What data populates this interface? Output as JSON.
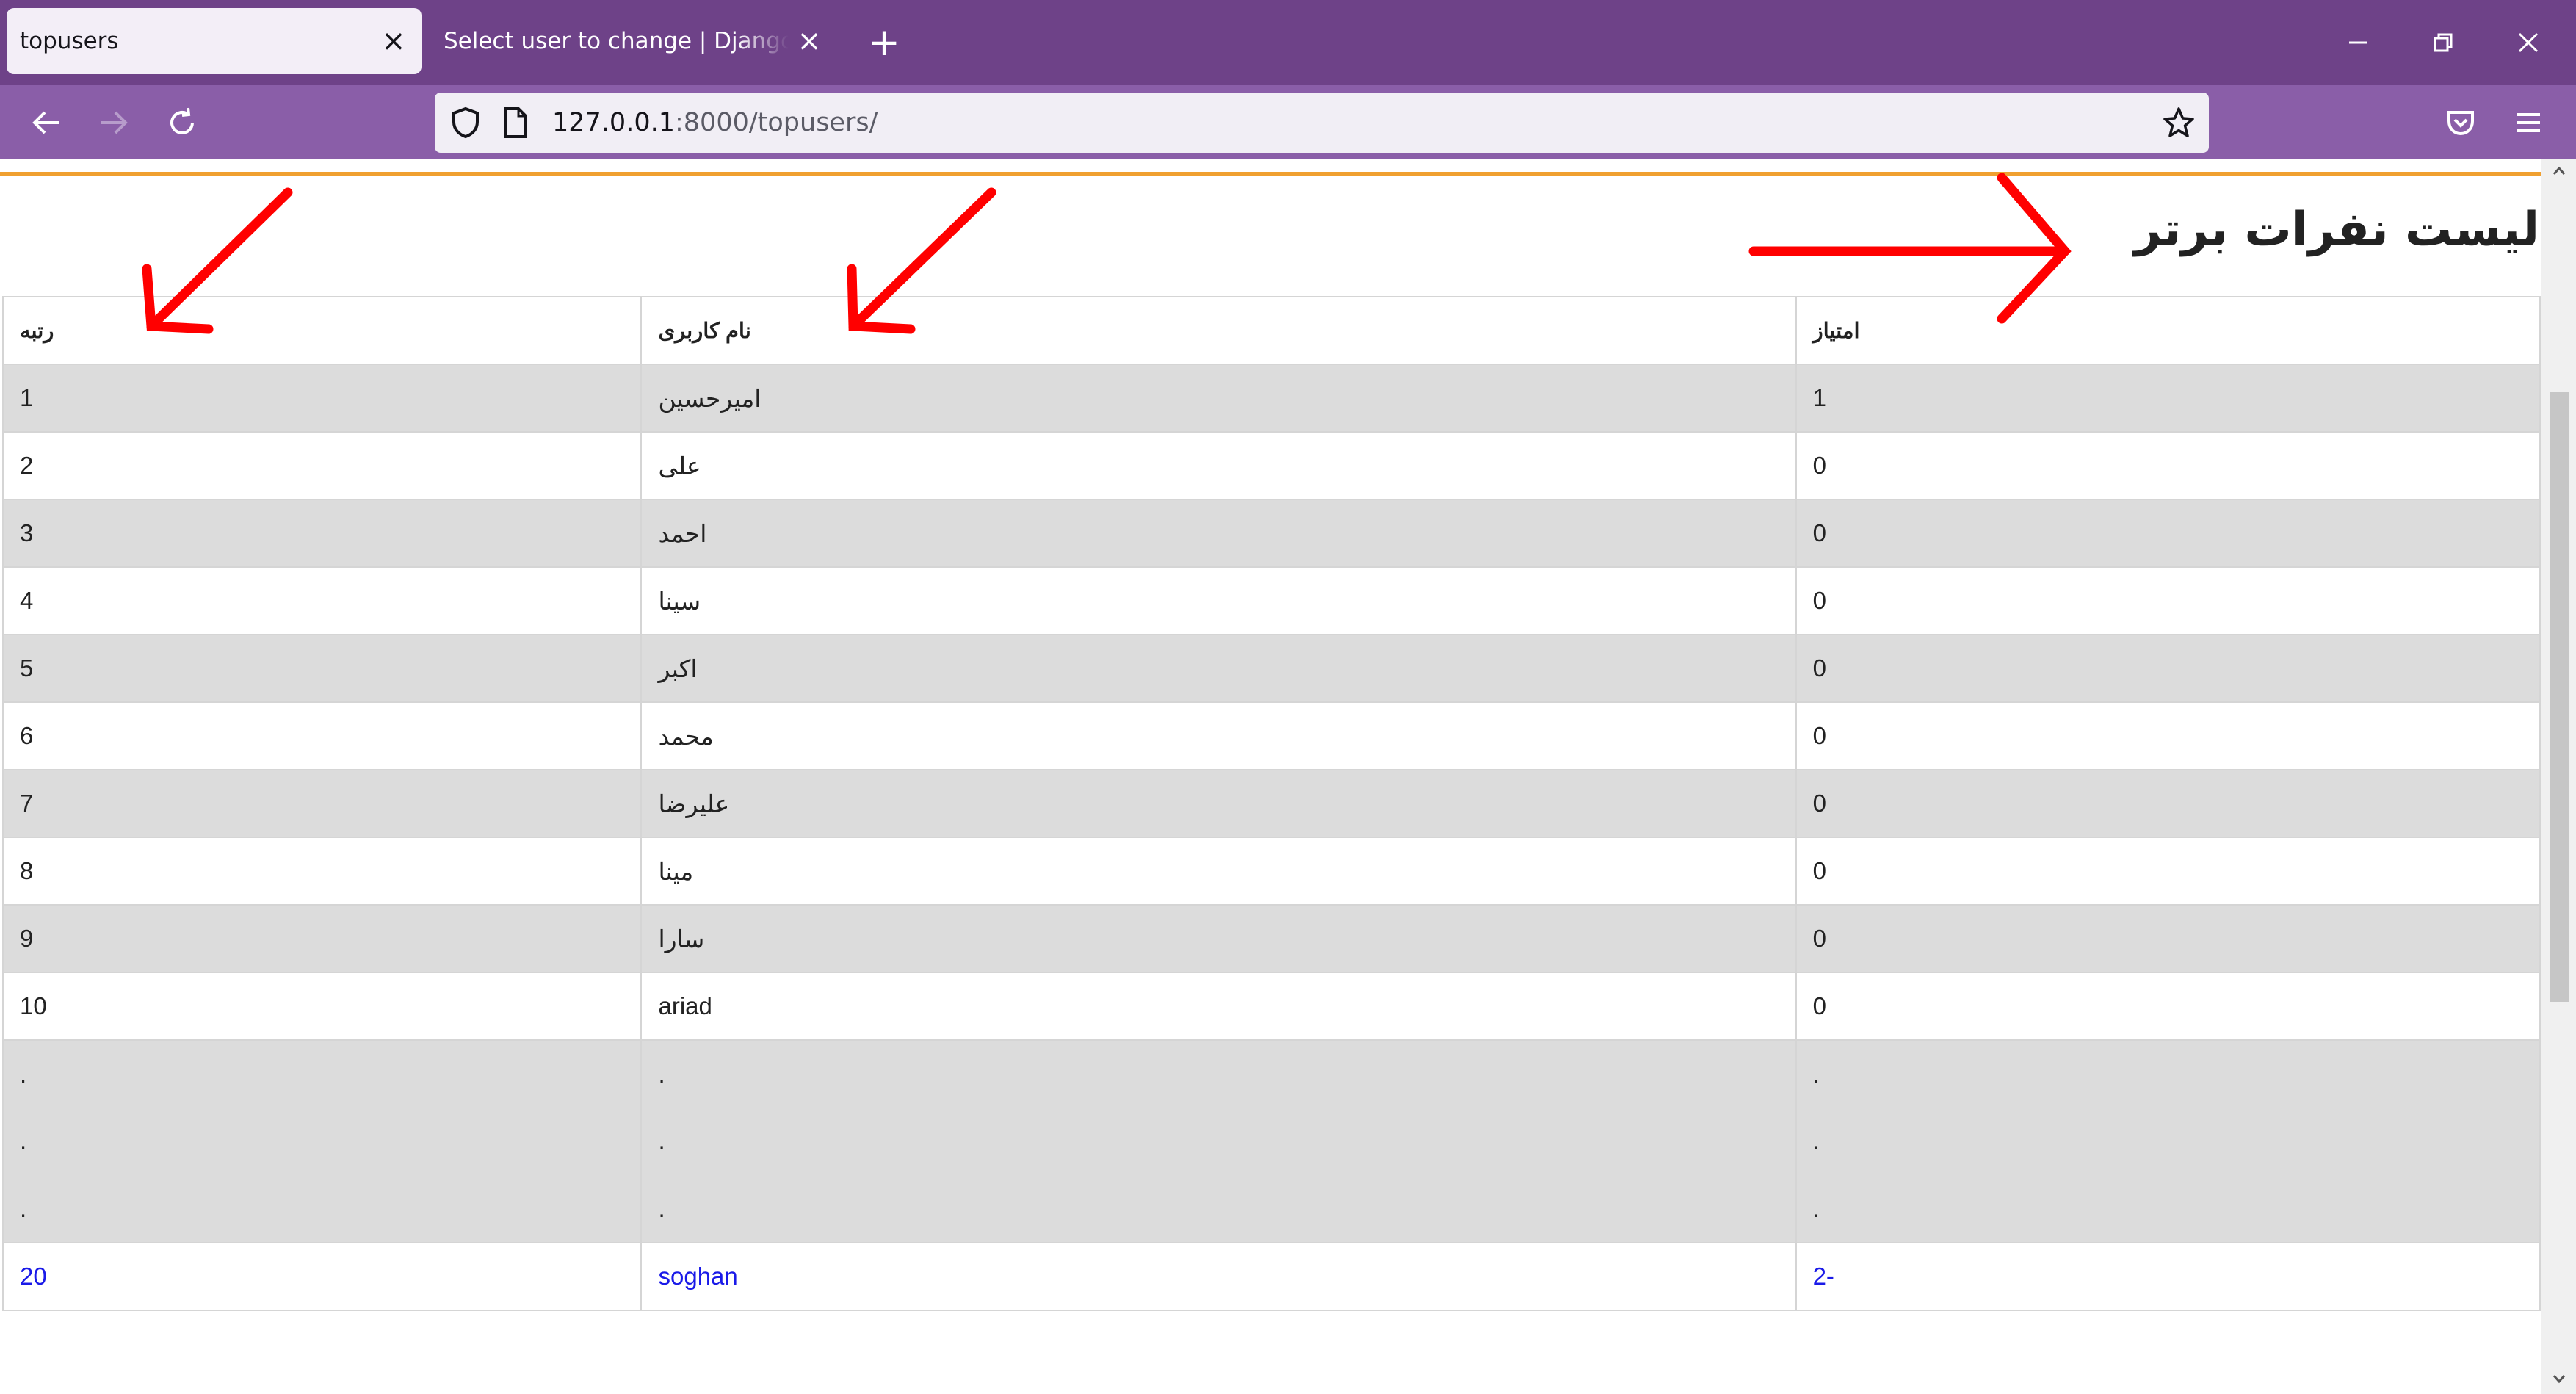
{
  "browser": {
    "tabs": [
      {
        "title": "topusers",
        "active": true
      },
      {
        "title": "Select user to change | Django site admin",
        "active": false
      }
    ],
    "url_host": "127.0.0.1",
    "url_rest": ":8000/topusers/",
    "theme_color": "#6e4288"
  },
  "page": {
    "title": "لیست نفرات برتر"
  },
  "table": {
    "headers": {
      "rank": "رتبه",
      "username": "نام کاربری",
      "score": "امتیاز"
    },
    "rows": [
      {
        "rank": "1",
        "username": "امیرحسین",
        "score": "1"
      },
      {
        "rank": "2",
        "username": "علی",
        "score": "0"
      },
      {
        "rank": "3",
        "username": "احمد",
        "score": "0"
      },
      {
        "rank": "4",
        "username": "سینا",
        "score": "0"
      },
      {
        "rank": "5",
        "username": "اکبر",
        "score": "0"
      },
      {
        "rank": "6",
        "username": "محمد",
        "score": "0"
      },
      {
        "rank": "7",
        "username": "علیرضا",
        "score": "0"
      },
      {
        "rank": "8",
        "username": "مینا",
        "score": "0"
      },
      {
        "rank": "9",
        "username": "سارا",
        "score": "0"
      },
      {
        "rank": "10",
        "username": "ariad",
        "score": "0"
      }
    ],
    "ellipsis": [
      ".",
      ".",
      "."
    ],
    "last_row": {
      "rank": "20",
      "username": "soghan",
      "score": "2-"
    }
  },
  "colors": {
    "annotation_arrow": "#ff0000",
    "highlight_row_text": "#1a1ae8",
    "divider": "#f0a030"
  }
}
